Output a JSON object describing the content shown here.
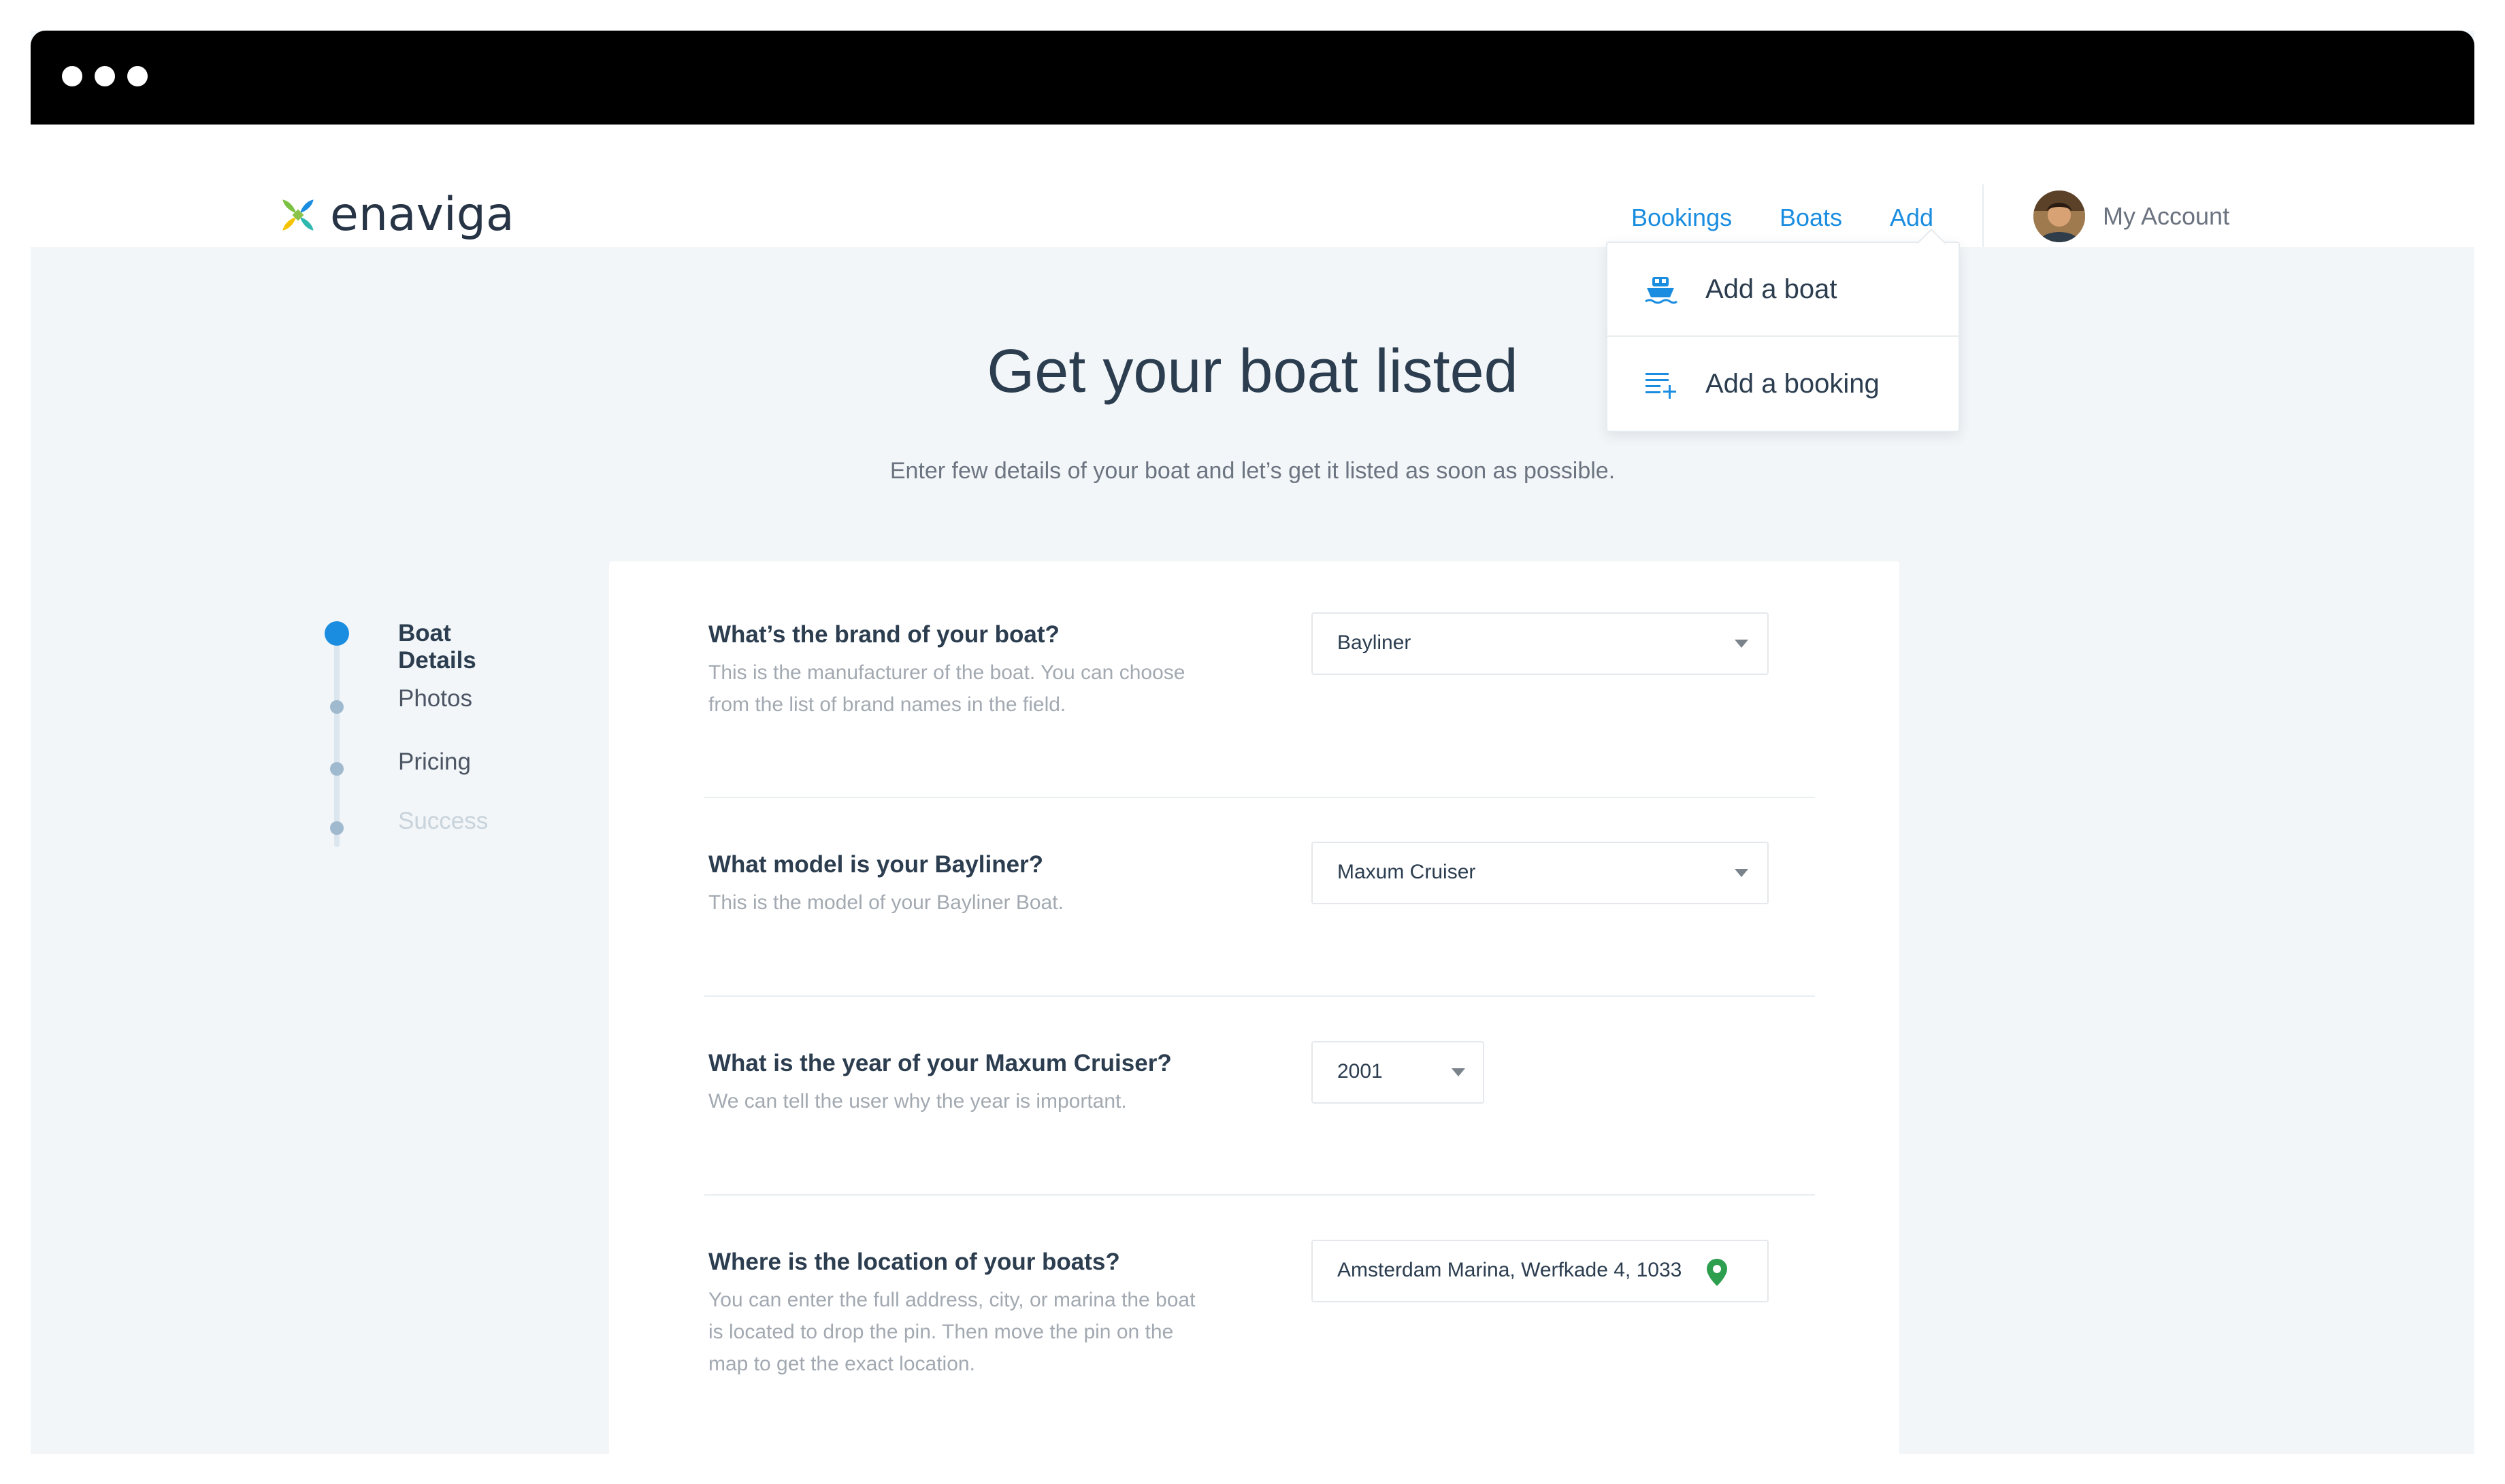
{
  "brand": {
    "name": "enaviga"
  },
  "nav": {
    "links": [
      "Bookings",
      "Boats",
      "Add"
    ],
    "account": "My Account"
  },
  "dropdown": {
    "items": [
      {
        "label": "Add a boat",
        "icon": "boat-icon"
      },
      {
        "label": "Add a booking",
        "icon": "add-list-icon"
      }
    ]
  },
  "hero": {
    "title": "Get your boat listed",
    "subtitle": "Enter few details of your boat and let’s get it listed as soon as possible."
  },
  "steps": [
    {
      "label": "Boat Details",
      "state": "active"
    },
    {
      "label": "Photos",
      "state": "pending"
    },
    {
      "label": "Pricing",
      "state": "pending"
    },
    {
      "label": "Success",
      "state": "disabled"
    }
  ],
  "form": {
    "brand": {
      "question": "What’s the brand of your boat?",
      "help": "This is the manufacturer of the boat. You can choose from the list of brand names in the field.",
      "value": "Bayliner"
    },
    "model": {
      "question": "What model is your Bayliner?",
      "help": "This is the model of your Bayliner Boat.",
      "value": "Maxum Cruiser"
    },
    "year": {
      "question": "What is the year of your Maxum Cruiser?",
      "help": "We can tell the user why the year is important.",
      "value": "2001"
    },
    "location": {
      "question": "Where is the location of your boats?",
      "help": "You can enter the full address, city, or marina the boat is located to drop the pin. Then move the pin on the map to get the exact location.",
      "value": "Amsterdam Marina, Werfkade 4, 1033"
    }
  },
  "colors": {
    "accent": "#1a8de0",
    "heading": "#2b3d4f",
    "page_bg": "#f2f6f8",
    "pin": "#2e9e4f"
  }
}
